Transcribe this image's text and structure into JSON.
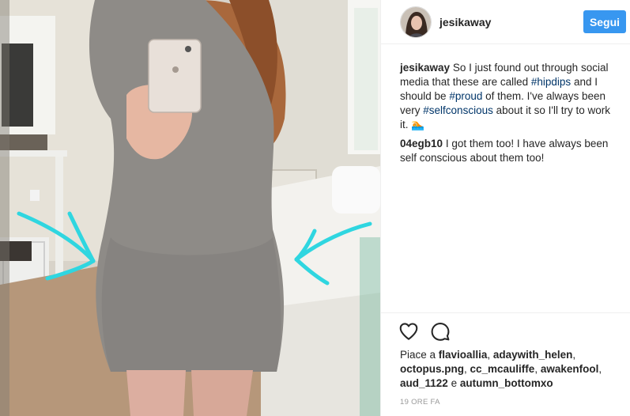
{
  "post": {
    "author": "jesikaway",
    "follow_label": "Segui"
  },
  "caption": {
    "author": "jesikaway",
    "text_1": "So I just found out through social media that these are called",
    "tag_1": "#hipdips",
    "text_2": "and I should be",
    "tag_2": "#proud",
    "text_3": "of them. I've always been very",
    "tag_3": "#selfconscious",
    "text_4": "about it so I'll try to work it.",
    "emoji": "🏊"
  },
  "comment": {
    "author": "04egb10",
    "text": "I got them too! I have always been self conscious about them too!"
  },
  "likes": {
    "prefix": "Piace a",
    "users": [
      "flavioallia",
      "adaywith_helen",
      "octopus.png",
      "cc_mcauliffe",
      "awakenfool",
      "aud_1122"
    ],
    "conjunction": "e",
    "last_user": "autumn_bottomxo"
  },
  "timestamp": "19 ORE FA",
  "icons": {
    "like": "heart-icon",
    "comment": "comment-bubble-icon"
  },
  "colors": {
    "accent": "#3897f0",
    "hashtag": "#003569",
    "arrow": "#2fd6e0"
  }
}
